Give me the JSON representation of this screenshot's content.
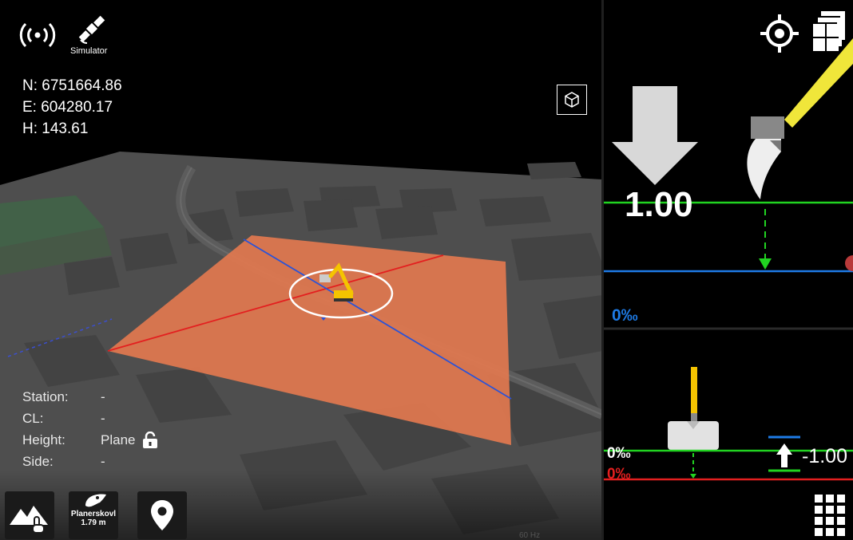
{
  "status": {
    "simulator_label": "Simulator"
  },
  "coords": {
    "n": "N: 6751664.86",
    "e": "E: 604280.17",
    "h": "H: 143.61"
  },
  "info": {
    "station_label": "Station:",
    "station_value": "-",
    "cl_label": "CL:",
    "cl_value": "-",
    "height_label": "Height:",
    "height_value": "Plane",
    "side_label": "Side:",
    "side_value": "-"
  },
  "toolbar": {
    "bucket_name": "Planerskovl",
    "bucket_width": "1.79 m",
    "frequency": "60 Hz"
  },
  "upper_guidance": {
    "value": "1.00",
    "slope": "0‰"
  },
  "lower_guidance": {
    "slope_current": "0‰",
    "slope_target": "0‰",
    "value": "-1.00"
  },
  "colors": {
    "design_plane": "#e2784f",
    "green_line": "#21d321",
    "blue_line": "#1e7be6",
    "red_line": "#e31f1f",
    "machine": "#f5c400"
  },
  "icons": [
    "signal-icon",
    "satellite-icon",
    "view-cube-icon",
    "lock-open-icon",
    "terrain-touch-icon",
    "bucket-icon",
    "location-pin-icon",
    "target-icon",
    "layers-icon",
    "grid-menu-icon",
    "down-arrow-icon",
    "up-arrow-icon"
  ]
}
